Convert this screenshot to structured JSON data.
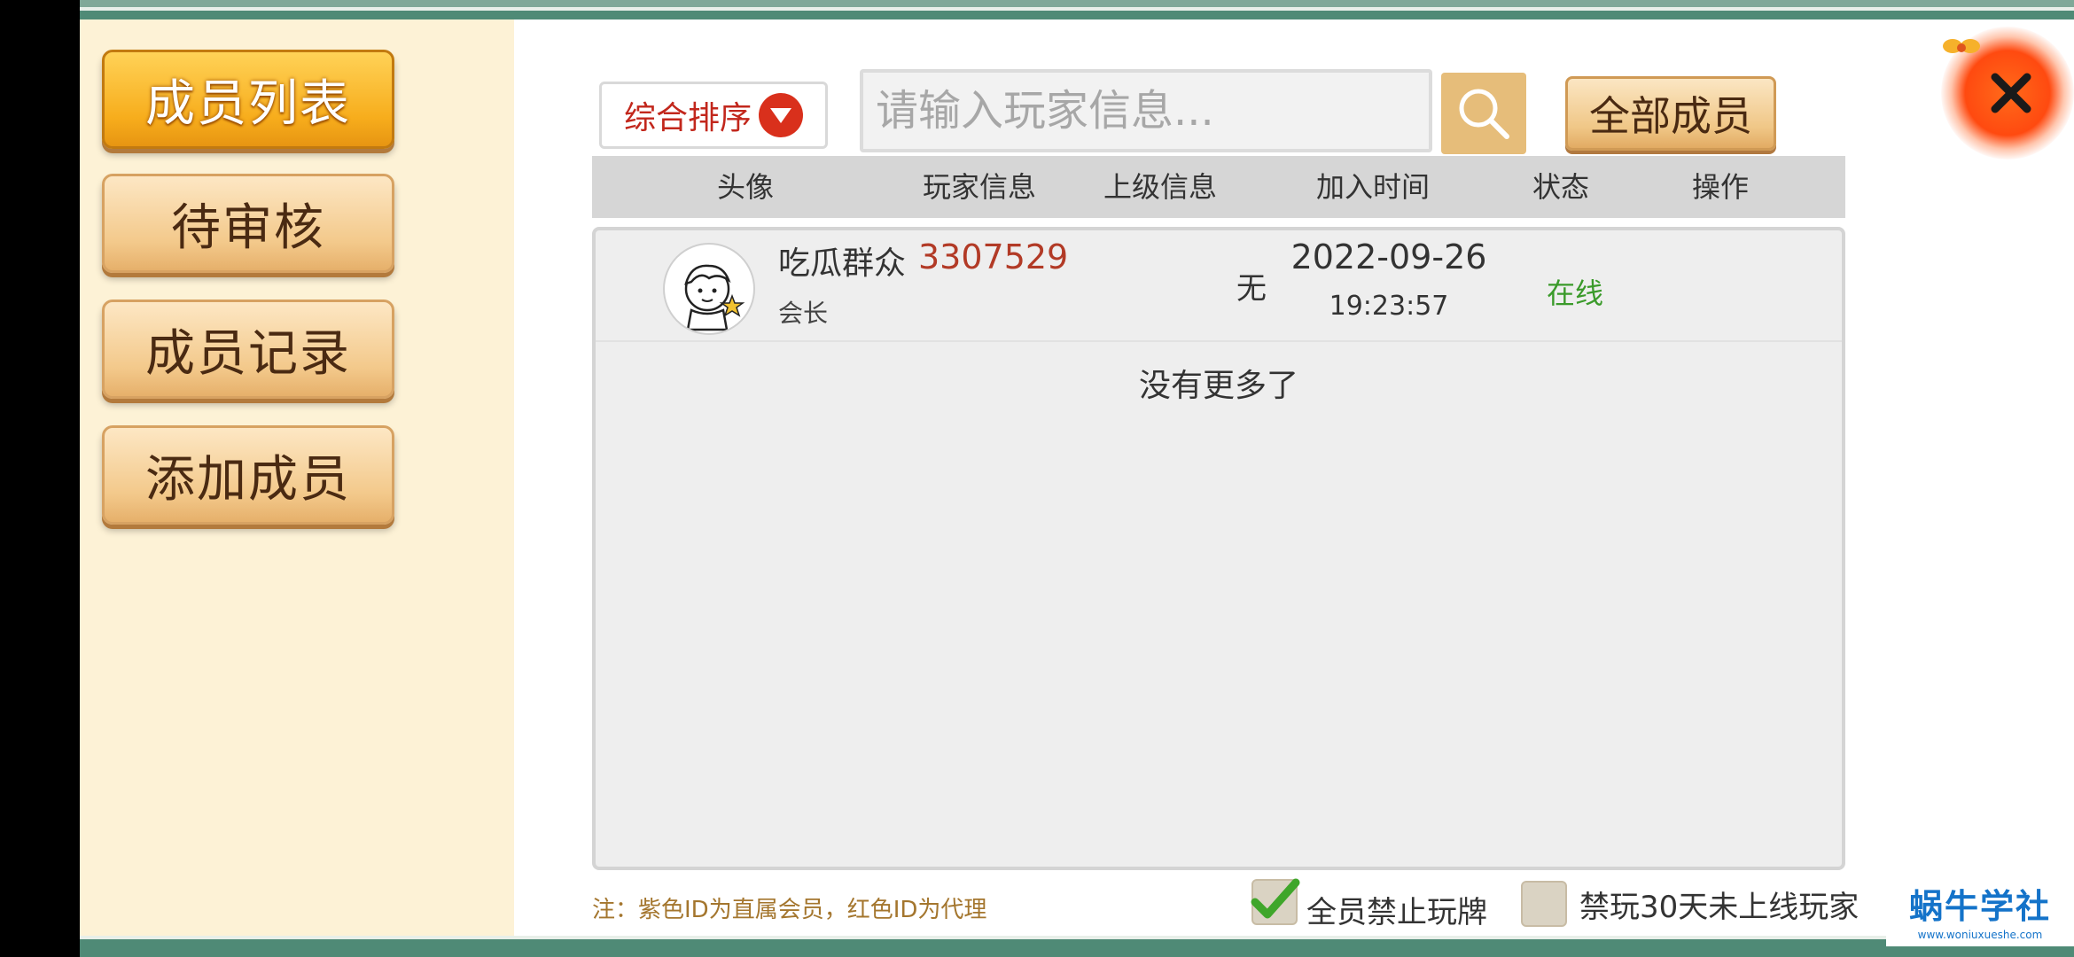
{
  "sidebar": {
    "items": [
      {
        "label": "成员列表",
        "active": true
      },
      {
        "label": "待审核",
        "active": false
      },
      {
        "label": "成员记录",
        "active": false
      },
      {
        "label": "添加成员",
        "active": false
      }
    ]
  },
  "toolbar": {
    "sort_label": "综合排序",
    "search_placeholder": "请输入玩家信息...",
    "all_members_label": "全部成员"
  },
  "table": {
    "headers": [
      "头像",
      "玩家信息",
      "上级信息",
      "加入时间",
      "状态",
      "操作"
    ],
    "rows": [
      {
        "avatar_icon": "cartoon-avatar-icon",
        "name": "吃瓜群众",
        "id": "3307529",
        "role": "会长",
        "parent": "无",
        "join_date": "2022-09-26",
        "join_time": "19:23:57",
        "status": "在线"
      }
    ],
    "empty_message": "没有更多了"
  },
  "footer": {
    "note": "注：紫色ID为直属会员，红色ID为代理",
    "checkbox_ban_all": {
      "label": "全员禁止玩牌",
      "checked": true
    },
    "checkbox_ban_inactive": {
      "label": "禁玩30天未上线玩家",
      "checked": false
    }
  },
  "watermark": {
    "main": "蜗牛学社",
    "sub": "www.woniuxueshe.com"
  },
  "colors": {
    "active_tab": "#f7ad1c",
    "id_red": "#b23a26",
    "status_online": "#3a9a2a",
    "sort_red": "#c2271c",
    "watermark_blue": "#1473c9"
  }
}
